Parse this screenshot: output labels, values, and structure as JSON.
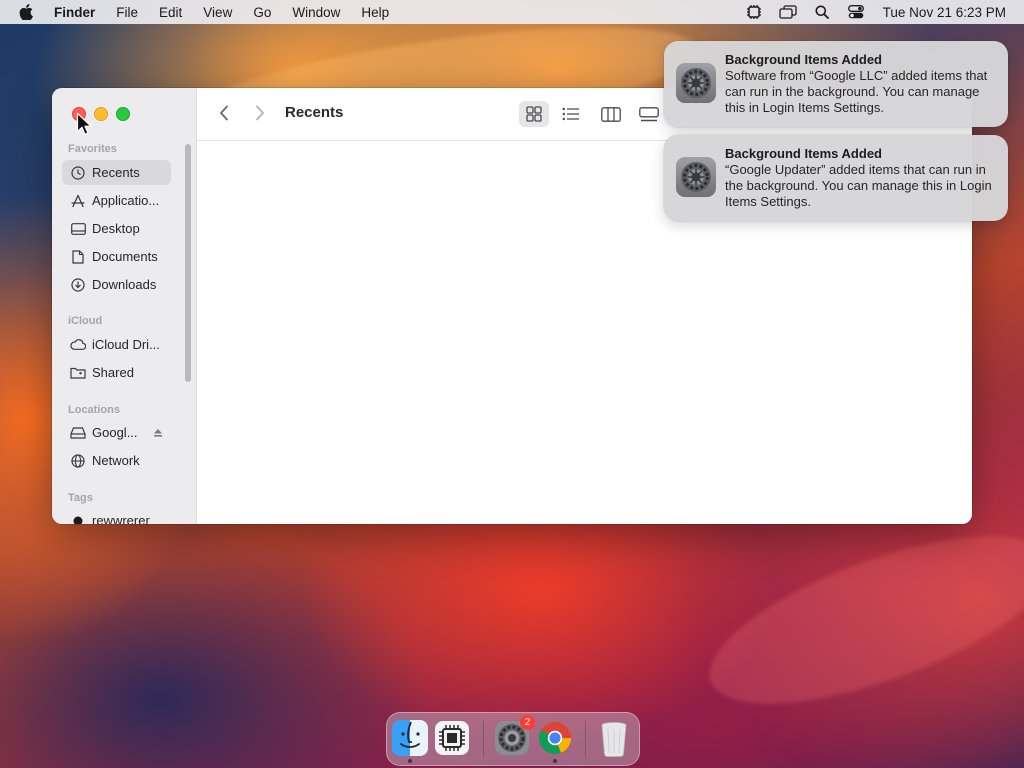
{
  "menubar": {
    "app_name": "Finder",
    "items": [
      "File",
      "Edit",
      "View",
      "Go",
      "Window",
      "Help"
    ],
    "clock": "Tue Nov 21  6:23 PM"
  },
  "finder": {
    "title": "Recents",
    "sidebar": {
      "favorites_label": "Favorites",
      "favorites": [
        {
          "label": "Recents",
          "icon": "clock-icon"
        },
        {
          "label": "Applicatio...",
          "icon": "applications-icon"
        },
        {
          "label": "Desktop",
          "icon": "desktop-icon"
        },
        {
          "label": "Documents",
          "icon": "document-icon"
        },
        {
          "label": "Downloads",
          "icon": "download-icon"
        }
      ],
      "icloud_label": "iCloud",
      "icloud": [
        {
          "label": "iCloud Dri...",
          "icon": "cloud-icon"
        },
        {
          "label": "Shared",
          "icon": "shared-folder-icon"
        }
      ],
      "locations_label": "Locations",
      "locations": [
        {
          "label": "Googl...",
          "icon": "drive-icon"
        },
        {
          "label": "Network",
          "icon": "globe-icon"
        }
      ],
      "tags_label": "Tags",
      "tags": [
        {
          "label": "rewwrerer",
          "color": "#1c1c1c"
        }
      ]
    }
  },
  "notifications": [
    {
      "title": "Background Items Added",
      "body": "Software from “Google LLC” added items that can run in the background. You can manage this in Login Items Settings."
    },
    {
      "title": "Background Items Added",
      "body": "“Google Updater” added items that can run in the background. You can manage this in Login Items Settings."
    }
  ],
  "dock": {
    "settings_badge": "2"
  },
  "colors": {
    "selection": "#d9d9dd",
    "close": "#ff5f57",
    "minimize": "#febc2e",
    "maximize": "#28c840",
    "badge": "#ff3b30"
  }
}
